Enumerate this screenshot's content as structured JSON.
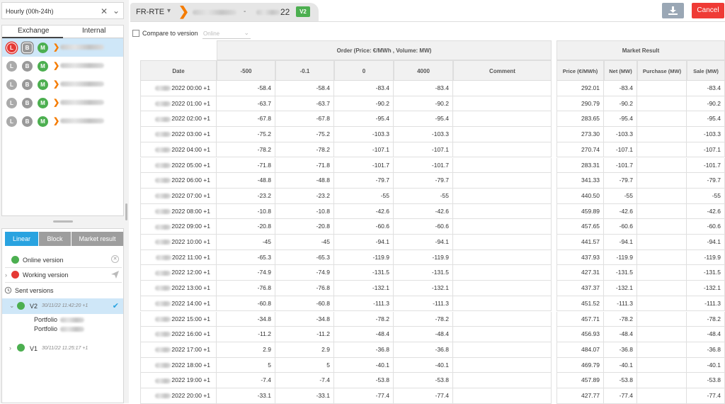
{
  "granularity": {
    "value": "Hourly (00h-24h)"
  },
  "exchange_tabs": [
    "Exchange",
    "Internal"
  ],
  "exchange_rows": [
    {
      "badges": [
        "L",
        "B",
        "M"
      ]
    },
    {
      "badges": [
        "L",
        "B",
        "M"
      ]
    },
    {
      "badges": [
        "L",
        "B",
        "M"
      ]
    },
    {
      "badges": [
        "L",
        "B",
        "M"
      ]
    },
    {
      "badges": [
        "L",
        "B",
        "M"
      ]
    }
  ],
  "version_tabs": [
    "Linear",
    "Block",
    "Market result"
  ],
  "versions": {
    "online_label": "Online version",
    "working_label": "Working version",
    "sent_label": "Sent versions",
    "v2_name": "V2",
    "v2_time": "30/11/22 11:42:20 +1",
    "portfolio_label": "Portfolio",
    "v1_name": "V1",
    "v1_time": "30/11/22 11:25:17 +1"
  },
  "header": {
    "area": "FR-RTE",
    "dash": "-",
    "year_suffix": "22",
    "version_badge": "V2",
    "cancel_label": "Cancel"
  },
  "compare": {
    "label": "Compare to version",
    "placeholder": "Online"
  },
  "order_table": {
    "group_title": "Order (Price: €/MWh , Volume: MW)",
    "columns": [
      "Date",
      "-500",
      "-0.1",
      "0",
      "4000",
      "Comment"
    ]
  },
  "market_table": {
    "group_title": "Market Result",
    "columns": [
      "Price (€/MWh)",
      "Net (MW)",
      "Purchase (MW)",
      "Sale (MW)"
    ]
  },
  "rows": [
    {
      "date": "2022 00:00 +1",
      "v1": "-58.4",
      "v2": "-58.4",
      "v3": "-83.4",
      "v4": "-83.4",
      "price": "292.01",
      "net": "-83.4",
      "sale": "-83.4"
    },
    {
      "date": "2022 01:00 +1",
      "v1": "-63.7",
      "v2": "-63.7",
      "v3": "-90.2",
      "v4": "-90.2",
      "price": "290.79",
      "net": "-90.2",
      "sale": "-90.2"
    },
    {
      "date": "2022 02:00 +1",
      "v1": "-67.8",
      "v2": "-67.8",
      "v3": "-95.4",
      "v4": "-95.4",
      "price": "283.65",
      "net": "-95.4",
      "sale": "-95.4"
    },
    {
      "date": "2022 03:00 +1",
      "v1": "-75.2",
      "v2": "-75.2",
      "v3": "-103.3",
      "v4": "-103.3",
      "price": "273.30",
      "net": "-103.3",
      "sale": "-103.3"
    },
    {
      "date": "2022 04:00 +1",
      "v1": "-78.2",
      "v2": "-78.2",
      "v3": "-107.1",
      "v4": "-107.1",
      "price": "270.74",
      "net": "-107.1",
      "sale": "-107.1"
    },
    {
      "date": "2022 05:00 +1",
      "v1": "-71.8",
      "v2": "-71.8",
      "v3": "-101.7",
      "v4": "-101.7",
      "price": "283.31",
      "net": "-101.7",
      "sale": "-101.7"
    },
    {
      "date": "2022 06:00 +1",
      "v1": "-48.8",
      "v2": "-48.8",
      "v3": "-79.7",
      "v4": "-79.7",
      "price": "341.33",
      "net": "-79.7",
      "sale": "-79.7"
    },
    {
      "date": "2022 07:00 +1",
      "v1": "-23.2",
      "v2": "-23.2",
      "v3": "-55",
      "v4": "-55",
      "price": "440.50",
      "net": "-55",
      "sale": "-55"
    },
    {
      "date": "2022 08:00 +1",
      "v1": "-10.8",
      "v2": "-10.8",
      "v3": "-42.6",
      "v4": "-42.6",
      "price": "459.89",
      "net": "-42.6",
      "sale": "-42.6"
    },
    {
      "date": "2022 09:00 +1",
      "v1": "-20.8",
      "v2": "-20.8",
      "v3": "-60.6",
      "v4": "-60.6",
      "price": "457.65",
      "net": "-60.6",
      "sale": "-60.6"
    },
    {
      "date": "2022 10:00 +1",
      "v1": "-45",
      "v2": "-45",
      "v3": "-94.1",
      "v4": "-94.1",
      "price": "441.57",
      "net": "-94.1",
      "sale": "-94.1"
    },
    {
      "date": "2022 11:00 +1",
      "v1": "-65.3",
      "v2": "-65.3",
      "v3": "-119.9",
      "v4": "-119.9",
      "price": "437.93",
      "net": "-119.9",
      "sale": "-119.9"
    },
    {
      "date": "2022 12:00 +1",
      "v1": "-74.9",
      "v2": "-74.9",
      "v3": "-131.5",
      "v4": "-131.5",
      "price": "427.31",
      "net": "-131.5",
      "sale": "-131.5"
    },
    {
      "date": "2022 13:00 +1",
      "v1": "-76.8",
      "v2": "-76.8",
      "v3": "-132.1",
      "v4": "-132.1",
      "price": "437.37",
      "net": "-132.1",
      "sale": "-132.1"
    },
    {
      "date": "2022 14:00 +1",
      "v1": "-60.8",
      "v2": "-60.8",
      "v3": "-111.3",
      "v4": "-111.3",
      "price": "451.52",
      "net": "-111.3",
      "sale": "-111.3"
    },
    {
      "date": "2022 15:00 +1",
      "v1": "-34.8",
      "v2": "-34.8",
      "v3": "-78.2",
      "v4": "-78.2",
      "price": "457.71",
      "net": "-78.2",
      "sale": "-78.2"
    },
    {
      "date": "2022 16:00 +1",
      "v1": "-11.2",
      "v2": "-11.2",
      "v3": "-48.4",
      "v4": "-48.4",
      "price": "456.93",
      "net": "-48.4",
      "sale": "-48.4"
    },
    {
      "date": "2022 17:00 +1",
      "v1": "2.9",
      "v2": "2.9",
      "v3": "-36.8",
      "v4": "-36.8",
      "price": "484.07",
      "net": "-36.8",
      "sale": "-36.8"
    },
    {
      "date": "2022 18:00 +1",
      "v1": "5",
      "v2": "5",
      "v3": "-40.1",
      "v4": "-40.1",
      "price": "469.79",
      "net": "-40.1",
      "sale": "-40.1"
    },
    {
      "date": "2022 19:00 +1",
      "v1": "-7.4",
      "v2": "-7.4",
      "v3": "-53.8",
      "v4": "-53.8",
      "price": "457.89",
      "net": "-53.8",
      "sale": "-53.8"
    },
    {
      "date": "2022 20:00 +1",
      "v1": "-33.1",
      "v2": "-33.1",
      "v3": "-77.4",
      "v4": "-77.4",
      "price": "427.77",
      "net": "-77.4",
      "sale": "-77.4"
    }
  ],
  "colors": {
    "accent": "#29a3e0",
    "cancel": "#ef3b36",
    "online": "#4caf50",
    "working": "#e53935",
    "arrow": "#f57c00"
  },
  "icons": {
    "download": "download-icon",
    "clear": "close-icon",
    "dropdown": "chevron-down-icon",
    "history": "history-icon",
    "send": "send-icon",
    "check": "check-icon"
  }
}
